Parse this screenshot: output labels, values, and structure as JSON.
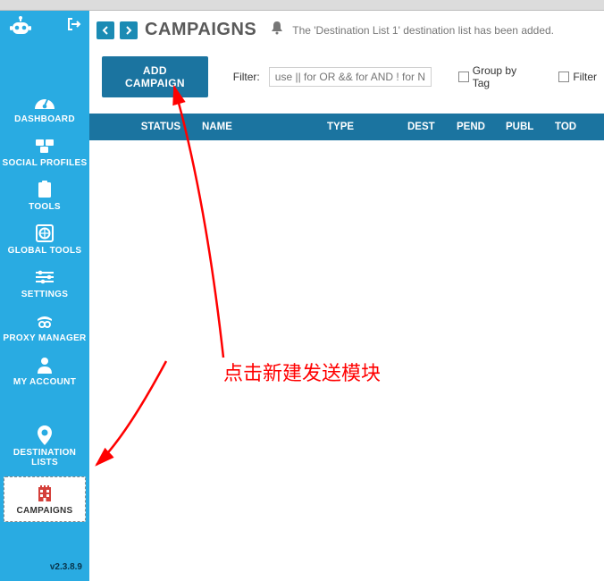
{
  "sidebar": {
    "items": [
      {
        "label": "DASHBOARD"
      },
      {
        "label": "SOCIAL PROFILES"
      },
      {
        "label": "TOOLS"
      },
      {
        "label": "GLOBAL TOOLS"
      },
      {
        "label": "SETTINGS"
      },
      {
        "label": "PROXY MANAGER"
      },
      {
        "label": "MY ACCOUNT"
      },
      {
        "label": "DESTINATION LISTS"
      },
      {
        "label": "CAMPAIGNS"
      }
    ],
    "version": "v2.3.8.9"
  },
  "header": {
    "title": "CAMPAIGNS",
    "notification": "The 'Destination List 1' destination list has been added."
  },
  "toolbar": {
    "add_label": "ADD CAMPAIGN",
    "filter_label": "Filter:",
    "filter_placeholder": "use || for OR && for AND ! for NOT",
    "group_by_tag_label": "Group by Tag",
    "filter_checkbox_label": "Filter"
  },
  "table": {
    "columns": {
      "status": "STATUS",
      "name": "NAME",
      "type": "TYPE",
      "dest": "DEST",
      "pend": "PEND",
      "publ": "PUBL",
      "tod": "TOD"
    },
    "rows": []
  },
  "annotation": {
    "text": "点击新建发送模块"
  }
}
